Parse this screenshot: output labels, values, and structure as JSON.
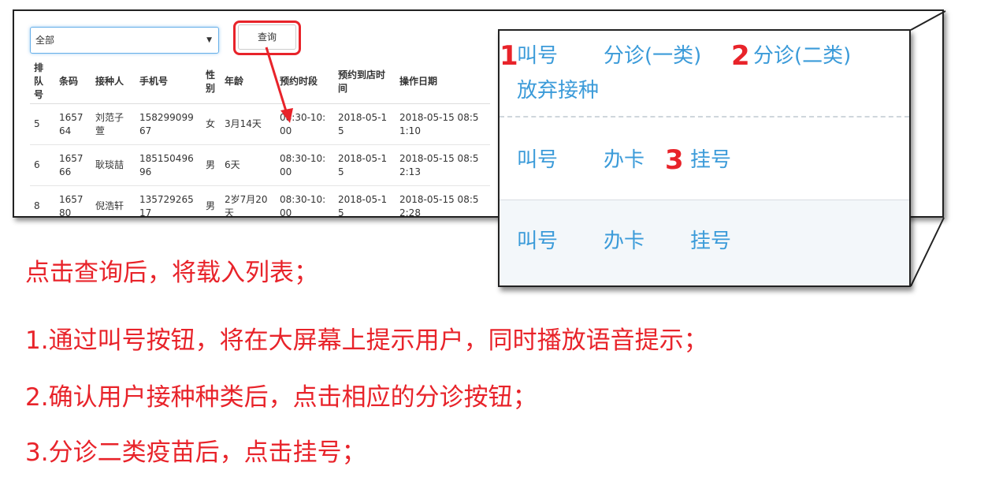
{
  "filter": {
    "selected": "全部"
  },
  "toolbar": {
    "query_label": "查询"
  },
  "table": {
    "headers": [
      "排队号",
      "条码",
      "接种人",
      "手机号",
      "性别",
      "年龄",
      "预约时段",
      "预约到店时间",
      "操作日期"
    ],
    "rows": [
      [
        "5",
        "165764",
        "刘范子萱",
        "15829909967",
        "女",
        "3月14天",
        "08:30-10:00",
        "2018-05-15",
        "2018-05-15 08:51:10"
      ],
      [
        "6",
        "165766",
        "耿琰喆",
        "18515049696",
        "男",
        "6天",
        "08:30-10:00",
        "2018-05-15",
        "2018-05-15 08:52:13"
      ],
      [
        "8",
        "165780",
        "倪浩轩",
        "13572926517",
        "男",
        "2岁7月20天",
        "08:30-10:00",
        "2018-05-15",
        "2018-05-15 08:52:28"
      ]
    ]
  },
  "zoom": {
    "row1": {
      "call": "叫号",
      "triage1": "分诊(一类)",
      "triage2": "分诊(二类)",
      "abandon": "放弃接种"
    },
    "row2": {
      "call": "叫号",
      "card": "办卡",
      "register": "挂号"
    },
    "row3": {
      "call": "叫号",
      "card": "办卡",
      "register": "挂号"
    },
    "markers": [
      "1",
      "2",
      "3"
    ]
  },
  "captions": [
    "点击查询后，将载入列表；",
    "1.通过叫号按钮，将在大屏幕上提示用户，同时播放语音提示；",
    "2.确认用户接种种类后，点击相应的分诊按钮；",
    "3.分诊二类疫苗后，点击挂号；"
  ],
  "colors": {
    "annotation_red": "#e8232a",
    "link_blue": "#3b9bd9",
    "focus_blue": "#66afe9"
  }
}
